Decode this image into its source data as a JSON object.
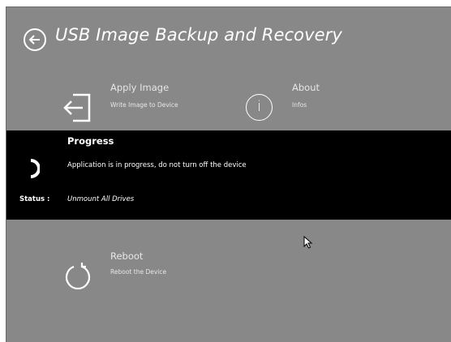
{
  "header": {
    "title": "USB Image Backup and Recovery",
    "back_icon": "back-arrow-circle-icon"
  },
  "tiles": {
    "apply": {
      "title": "Apply Image",
      "description": "Write Image to Device",
      "icon": "apply-image-icon"
    },
    "about": {
      "title": "About",
      "description": "Infos",
      "icon": "info-icon",
      "glyph": "i"
    },
    "reboot": {
      "title": "Reboot",
      "description": "Reboot the Device",
      "icon": "reboot-icon"
    }
  },
  "progress": {
    "title": "Progress",
    "message": "Application is in progress, do not turn off the device",
    "status_label": "Status :",
    "status_value": "Unmount All Drives"
  },
  "colors": {
    "background": "#888888",
    "dialog": "#000000",
    "text": "#ffffff"
  }
}
